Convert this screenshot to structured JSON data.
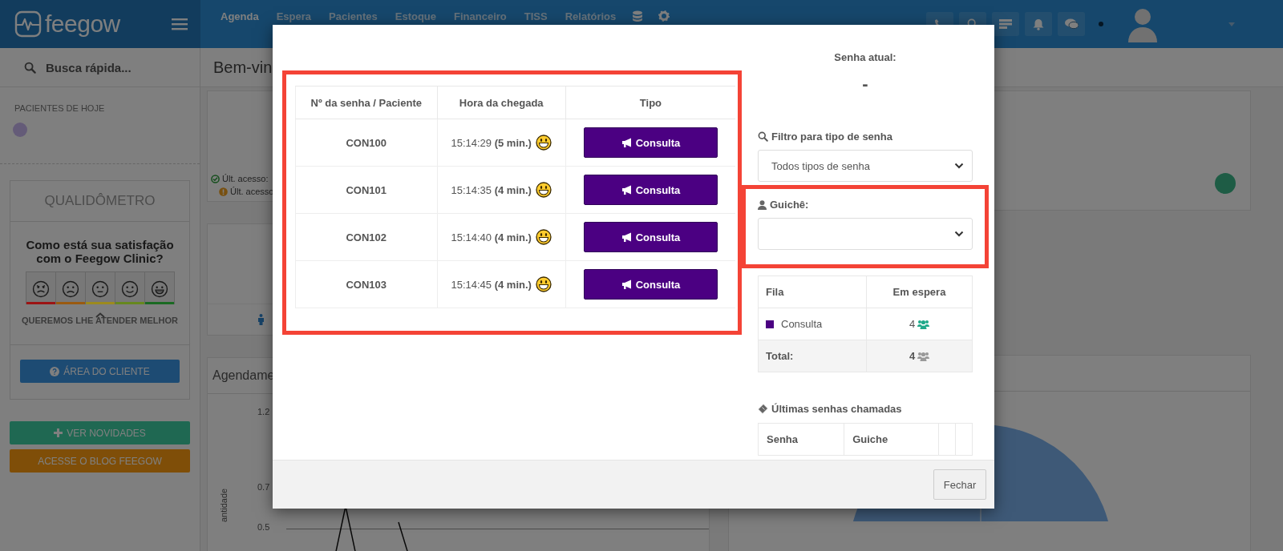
{
  "header": {
    "logo": "feegow",
    "nav": [
      {
        "label": "Agenda",
        "selected": true
      },
      {
        "label": "Espera",
        "selected": false
      },
      {
        "label": "Pacientes",
        "selected": false
      },
      {
        "label": "Estoque",
        "selected": false
      },
      {
        "label": "Financeiro",
        "selected": false
      },
      {
        "label": "TISS",
        "selected": false
      },
      {
        "label": "Relatórios",
        "selected": false
      }
    ]
  },
  "sidebar": {
    "search_placeholder": "Busca rápida...",
    "section_title": "PACIENTES DE HOJE",
    "qualidometro": {
      "title": "QUALIDÔMETRO",
      "question": "Como está sua satisfação com o Feegow Clinic?",
      "ratings": [
        {
          "kind": "angry",
          "color": "#9c1414"
        },
        {
          "kind": "sad",
          "color": "#9a5a10"
        },
        {
          "kind": "neutral",
          "color": "#9c8a1e"
        },
        {
          "kind": "smile",
          "color": "#66881e"
        },
        {
          "kind": "grin",
          "color": "#1a6a22"
        }
      ],
      "caption": "QUEREMOS LHE ATENDER MELHOR",
      "button": "ÁREA DO CLIENTE"
    },
    "buttons": [
      {
        "kind": "news",
        "label": "VER NOVIDADES"
      },
      {
        "kind": "blog",
        "label": "ACESSE O BLOG FEEGOW"
      }
    ]
  },
  "main": {
    "greeting": "Bem-vin",
    "access": [
      {
        "kind": "ok",
        "text": "Últ. acesso:"
      },
      {
        "kind": "warn",
        "text": "Últ. acesso"
      }
    ],
    "chart_title": "Agendame",
    "axis_label": "antidade",
    "ticks": [
      "1.2",
      "0.7",
      "0.5"
    ]
  },
  "modal": {
    "queue_table": {
      "columns": [
        "Nº da senha / Paciente",
        "Hora da chegada",
        "Tipo"
      ],
      "rows": [
        {
          "ticket": "CON100",
          "arrival": "15:14:29 **(5 min.)**",
          "type": "Consulta"
        },
        {
          "ticket": "CON101",
          "arrival": "15:14:35 **(4 min.)**",
          "type": "Consulta"
        },
        {
          "ticket": "CON102",
          "arrival": "15:14:40 **(4 min.)**",
          "type": "Consulta"
        },
        {
          "ticket": "CON103",
          "arrival": "15:14:45 **(4 min.)**",
          "type": "Consulta"
        }
      ]
    },
    "current_label": "Senha atual:",
    "current_value": "-",
    "filter": {
      "label": "Filtro para tipo de senha",
      "value": "Todos tipos de senha"
    },
    "counter": {
      "label": "Guichê:"
    },
    "summary": {
      "columns": [
        "Fila",
        "Em espera"
      ],
      "rows": [
        {
          "name": "Consulta",
          "color": "#4b0082",
          "count": "4"
        }
      ],
      "total": {
        "label": "Total:",
        "count": "4"
      }
    },
    "last_called": {
      "title": "Últimas senhas chamadas",
      "columns": [
        "Senha",
        "Guiche"
      ]
    },
    "close_button": "Fechar"
  }
}
